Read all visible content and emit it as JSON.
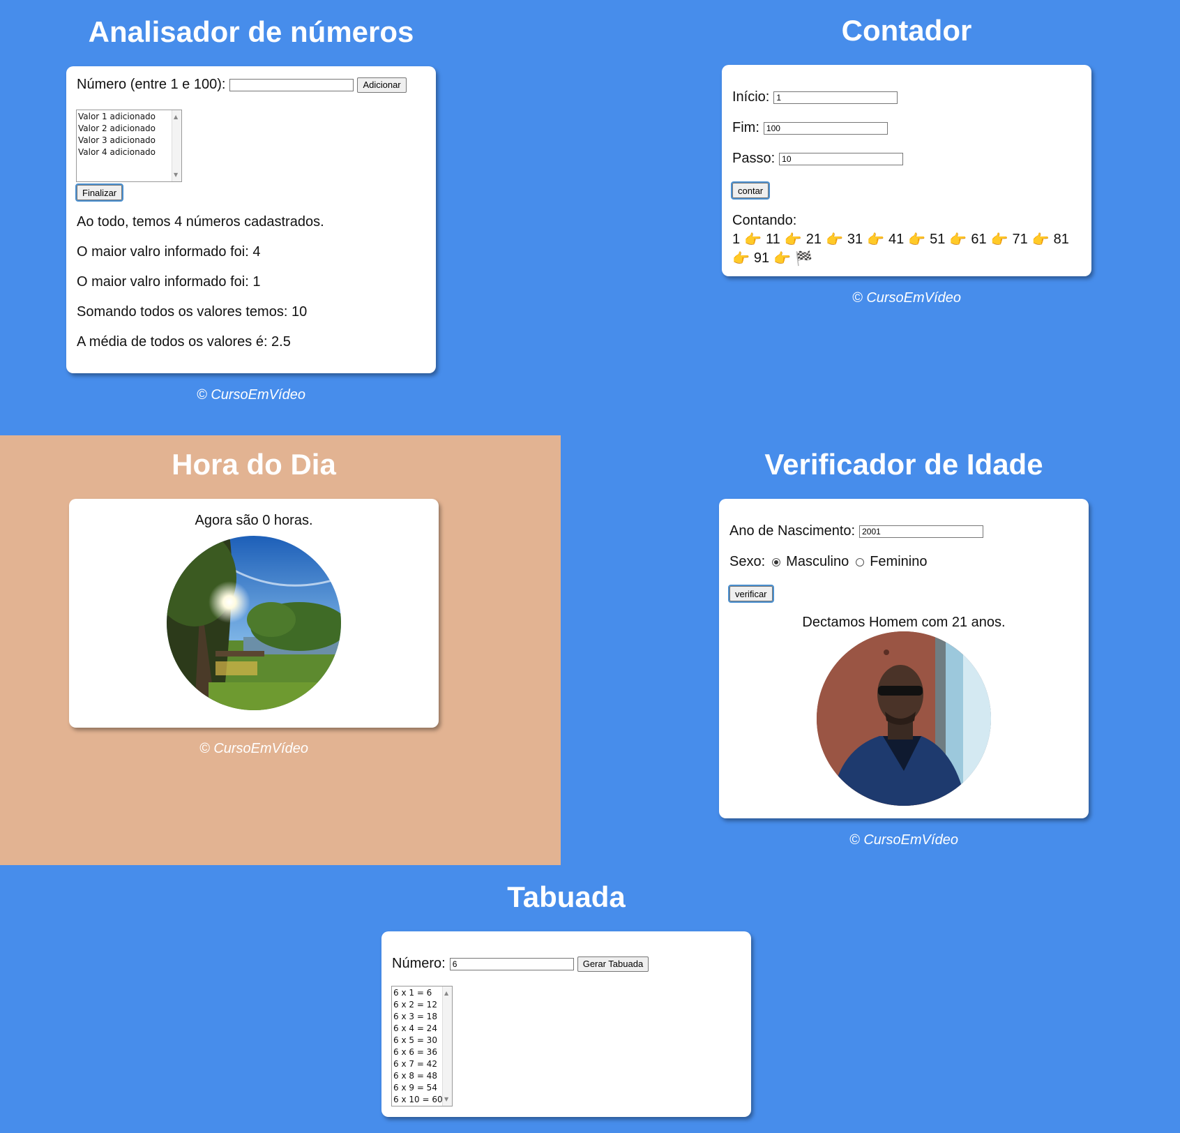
{
  "analisador": {
    "title": "Analisador de números",
    "input_label": "Número (entre 1 e 100):",
    "input_value": "",
    "add_button": "Adicionar",
    "list_items": [
      "Valor 1 adicionado",
      "Valor 2 adicionado",
      "Valor 3 adicionado",
      "Valor 4 adicionado"
    ],
    "finish_button": "Finalizar",
    "results": [
      "Ao todo, temos 4 números cadastrados.",
      "O maior valro informado foi: 4",
      "O maior valro informado foi: 1",
      "Somando todos os valores temos: 10",
      "A média de todos os valores é: 2.5"
    ],
    "footer": "© CursoEmVídeo"
  },
  "contador": {
    "title": "Contador",
    "inicio_label": "Início:",
    "inicio_value": "1",
    "fim_label": "Fim:",
    "fim_value": "100",
    "passo_label": "Passo:",
    "passo_value": "10",
    "count_button": "contar",
    "result_label": "Contando:",
    "numbers_line1": [
      "1",
      "11",
      "21",
      "31",
      "41",
      "51",
      "61",
      "71",
      "81"
    ],
    "numbers_line2": [
      "91"
    ],
    "hand_glyph": "👉",
    "flag_glyph": "🏁",
    "footer": "© CursoEmVídeo"
  },
  "hora": {
    "title": "Hora do Dia",
    "message": "Agora são 0 horas.",
    "image": "morning-park-photo",
    "background_color": "#e2b392",
    "footer": "© CursoEmVídeo"
  },
  "idade": {
    "title": "Verificador de Idade",
    "ano_label": "Ano de Nascimento:",
    "ano_value": "2001",
    "sexo_label": "Sexo:",
    "option_male": "Masculino",
    "option_female": "Feminino",
    "selected": "Masculino",
    "verify_button": "verificar",
    "result": "Dectamos Homem com 21 anos.",
    "image": "man-portrait-photo",
    "footer": "© CursoEmVídeo"
  },
  "tabuada": {
    "title": "Tabuada",
    "input_label": "Número:",
    "input_value": "6",
    "generate_button": "Gerar Tabuada",
    "rows": [
      "6 x 1 = 6",
      "6 x 2 = 12",
      "6 x 3 = 18",
      "6 x 4 = 24",
      "6 x 5 = 30",
      "6 x 6 = 36",
      "6 x 7 = 42",
      "6 x 8 = 48",
      "6 x 9 = 54",
      "6 x 10 = 60"
    ]
  },
  "colors": {
    "page_bg": "#478deb",
    "card_bg": "#ffffff",
    "title_color": "#ffffff"
  }
}
